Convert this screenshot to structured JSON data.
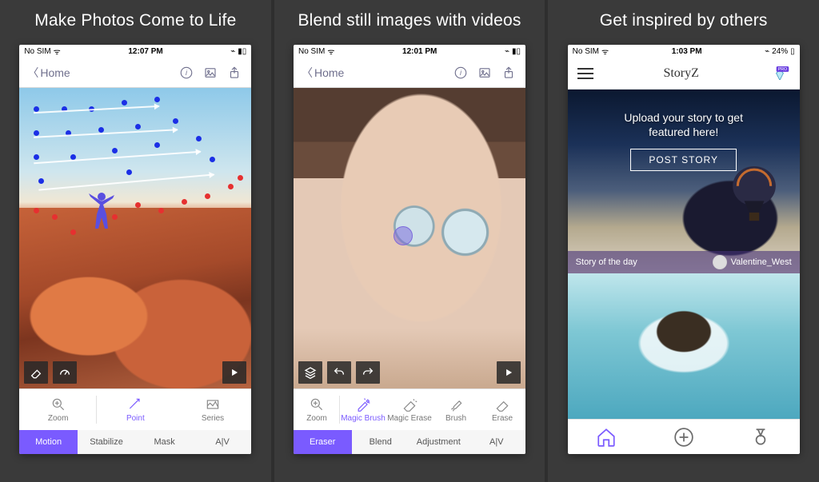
{
  "panels": [
    {
      "caption": "Make Photos Come to Life"
    },
    {
      "caption": "Blend still images with videos"
    },
    {
      "caption": "Get inspired by others"
    }
  ],
  "status": {
    "carrier": "No SIM",
    "time1": "12:07 PM",
    "time2": "12:01 PM",
    "time3": "1:03 PM",
    "battery3": "24%"
  },
  "nav": {
    "home": "Home"
  },
  "brand": "StoryZ",
  "pro_label": "PRO",
  "screen1": {
    "tools": [
      {
        "id": "zoom",
        "label": "Zoom"
      },
      {
        "id": "point",
        "label": "Point"
      },
      {
        "id": "series",
        "label": "Series"
      }
    ],
    "tabs": [
      {
        "id": "motion",
        "label": "Motion"
      },
      {
        "id": "stabilize",
        "label": "Stabilize"
      },
      {
        "id": "mask",
        "label": "Mask"
      },
      {
        "id": "av",
        "label": "A|V"
      }
    ]
  },
  "screen2": {
    "tools": [
      {
        "id": "zoom",
        "label": "Zoom"
      },
      {
        "id": "magicbrush",
        "label": "Magic Brush"
      },
      {
        "id": "magicerase",
        "label": "Magic Erase"
      },
      {
        "id": "brush",
        "label": "Brush"
      },
      {
        "id": "erase",
        "label": "Erase"
      }
    ],
    "tabs": [
      {
        "id": "eraser",
        "label": "Eraser"
      },
      {
        "id": "blend",
        "label": "Blend"
      },
      {
        "id": "adjustment",
        "label": "Adjustment"
      },
      {
        "id": "av",
        "label": "A|V"
      }
    ]
  },
  "screen3": {
    "hero_line1": "Upload your story to get",
    "hero_line2": "featured here!",
    "post_btn": "POST STORY",
    "story_of_day": "Story of the day",
    "author": "Valentine_West"
  }
}
